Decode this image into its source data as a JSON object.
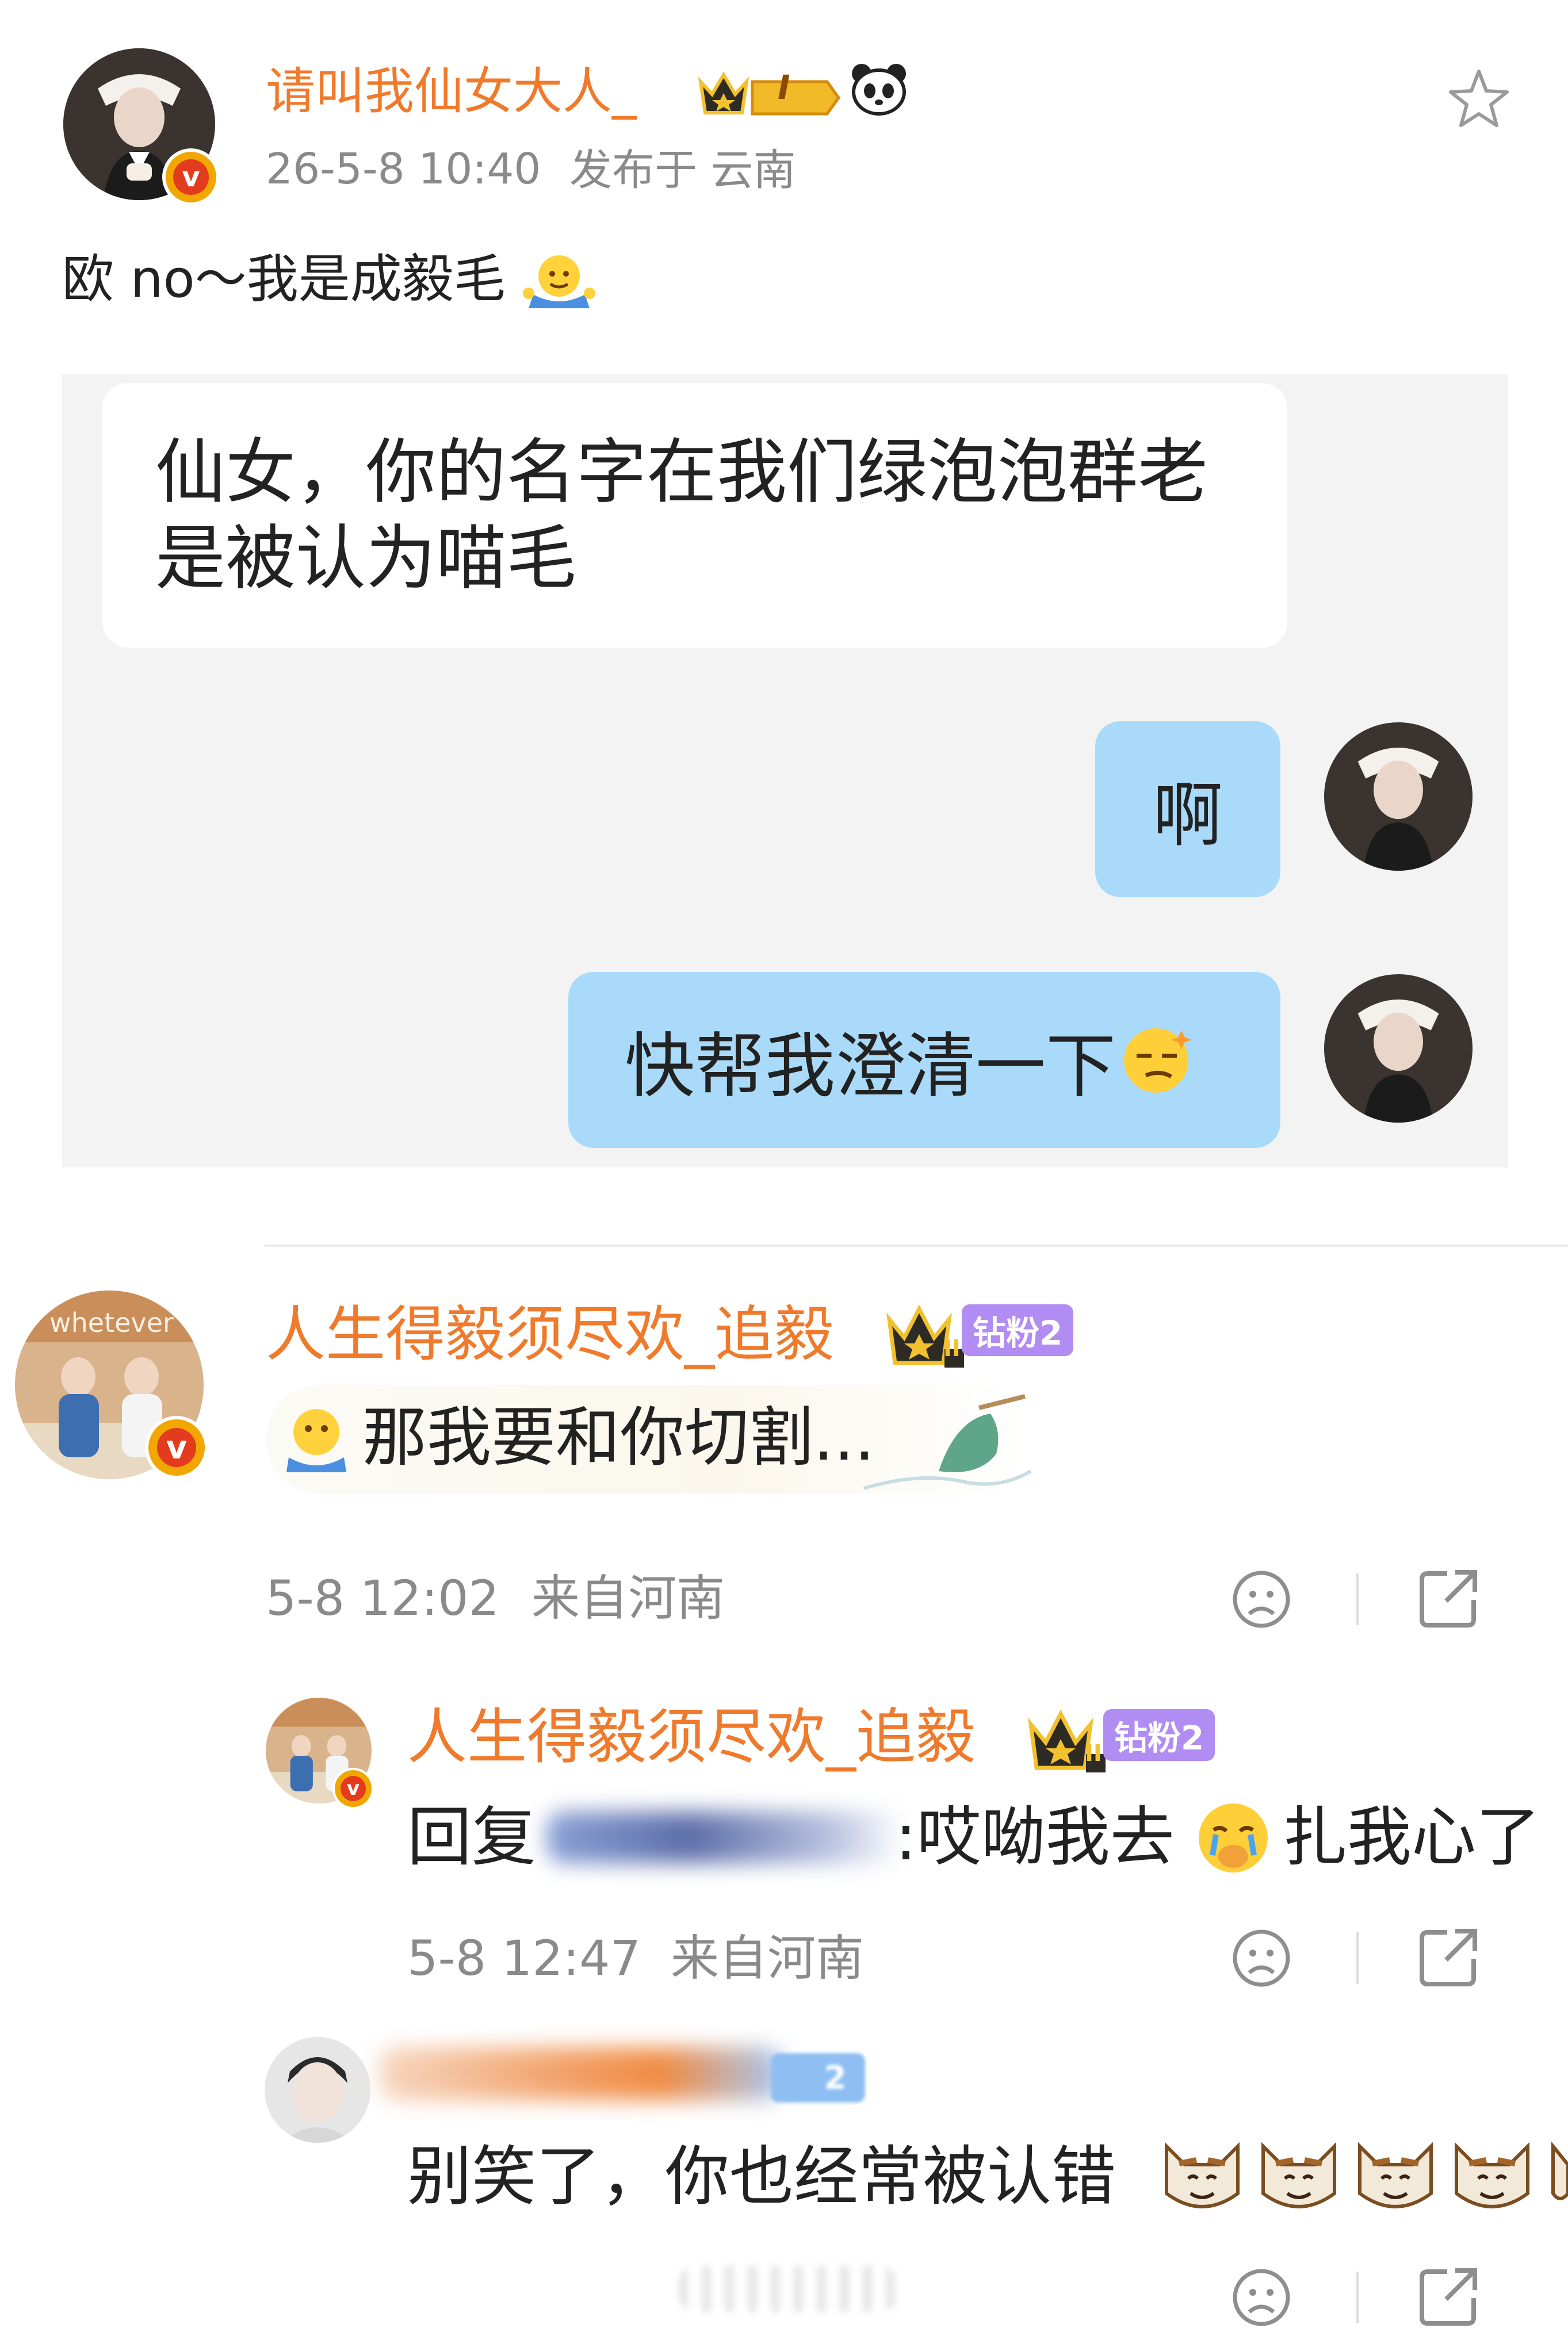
{
  "post": {
    "username": "请叫我仙女大人_",
    "vip_level": "I",
    "timestamp": "26-5-8 10:40",
    "location": "发布于 云南",
    "text": "欧 no～我是成毅毛",
    "chat": {
      "message_1": "仙女，你的名字在我们绿泡泡群老是被认为喵毛",
      "message_2": "啊",
      "message_3": "快帮我澄清一下"
    }
  },
  "comments": [
    {
      "username": "人生得毅须尽欢_追毅",
      "fan_badge": "钻粉2",
      "crown_level": "II",
      "text": "那我要和你切割...",
      "time": "5-8 12:02",
      "location": "来自河南"
    },
    {
      "username": "人生得毅须尽欢_追毅",
      "fan_badge": "钻粉2",
      "crown_level": "II",
      "reply_prefix": "回复",
      "text_a": ":哎呦我去",
      "text_b": "扎我心了",
      "time": "5-8 12:47",
      "location": "来自河南"
    },
    {
      "fan_badge": "2",
      "text": "别笑了，你也经常被认错"
    }
  ],
  "colors": {
    "username": "#f07a2b",
    "chat_bg": "#f3f3f3",
    "bubble_blue": "#a9daf9",
    "fan_badge": "#b18cf2"
  }
}
